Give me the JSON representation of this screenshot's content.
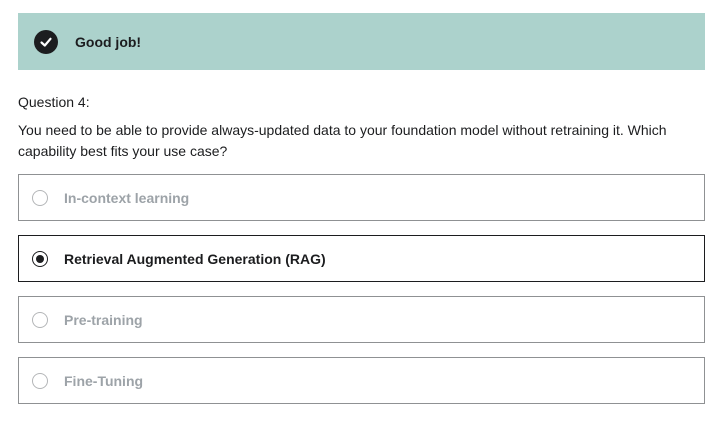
{
  "banner": {
    "icon": "checkmark-icon",
    "message": "Good job!",
    "color": "#acd2cc"
  },
  "question": {
    "label": "Question 4:",
    "text": "You need to be able to provide always-updated data to your foundation model without retraining it. Which capability best fits your use case?"
  },
  "options": [
    {
      "label": "In-context learning",
      "selected": false
    },
    {
      "label": "Retrieval Augmented Generation (RAG)",
      "selected": true
    },
    {
      "label": "Pre-training",
      "selected": false
    },
    {
      "label": "Fine-Tuning",
      "selected": false
    }
  ]
}
